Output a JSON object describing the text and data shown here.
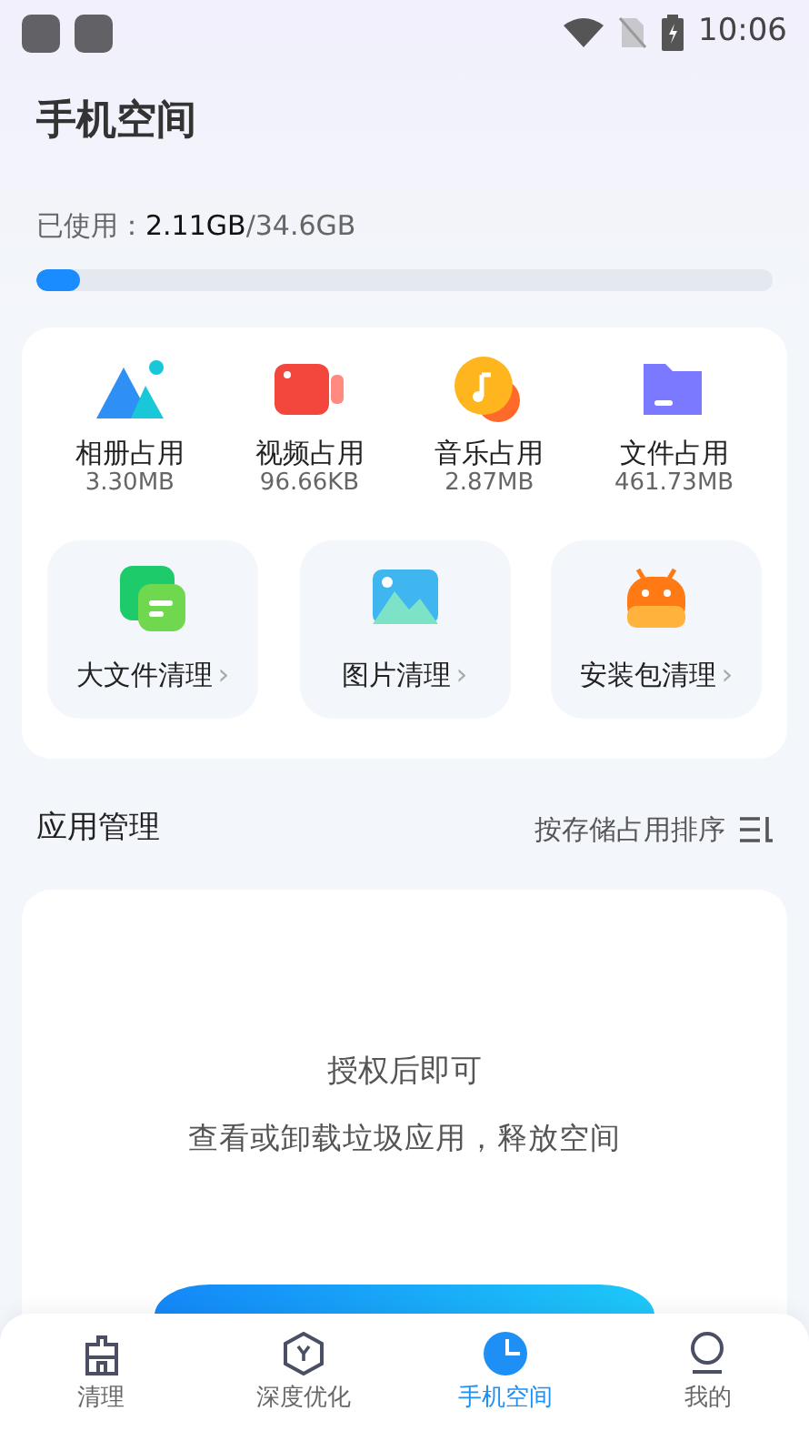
{
  "status_bar": {
    "time": "10:06"
  },
  "title": "手机空间",
  "storage": {
    "label": "已使用：",
    "used": "2.11GB",
    "total": "/34.6GB",
    "level": 0.06
  },
  "usage": [
    {
      "kind": "photos",
      "label": "相册占用",
      "size": "3.30MB"
    },
    {
      "kind": "video",
      "label": "视频占用",
      "size": "96.66KB"
    },
    {
      "kind": "music",
      "label": "音乐占用",
      "size": "2.87MB"
    },
    {
      "kind": "files",
      "label": "文件占用",
      "size": "461.73MB"
    }
  ],
  "cleanup": [
    {
      "kind": "large-files",
      "label": "大文件清理",
      "chevron": "›"
    },
    {
      "kind": "images",
      "label": "图片清理",
      "chevron": "›"
    },
    {
      "kind": "apk",
      "label": "安装包清理",
      "chevron": "›"
    }
  ],
  "app_management": {
    "title": "应用管理",
    "sort": "按存储占用排序",
    "message": "授权后即可",
    "description": "查看或卸载垃圾应用，释放空间"
  },
  "nav": [
    {
      "kind": "clean",
      "label": "清理",
      "selected": false
    },
    {
      "kind": "optimize",
      "label": "深度优化",
      "selected": false
    },
    {
      "kind": "space",
      "label": "手机空间",
      "selected": true
    },
    {
      "kind": "me",
      "label": "我的",
      "selected": false
    }
  ]
}
